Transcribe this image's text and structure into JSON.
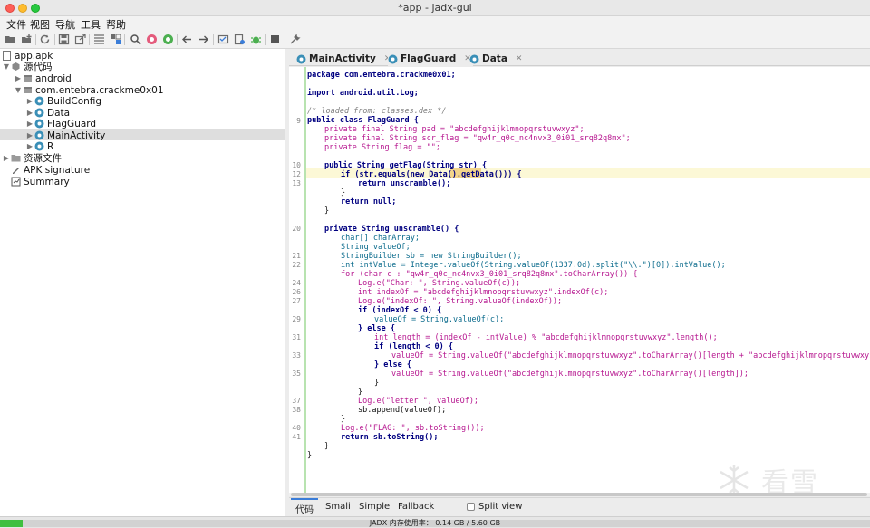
{
  "window": {
    "title": "*app - jadx-gui"
  },
  "menu": [
    "文件",
    "视图",
    "导航",
    "工具",
    "帮助"
  ],
  "toolbar_icons": [
    "open-icon",
    "add-files-icon",
    "reload-icon",
    "save-icon",
    "export-icon",
    "flatten-icon",
    "sync-icon",
    "search-icon",
    "find-class-icon",
    "find-usage-icon",
    "back-icon",
    "forward-icon",
    "quark-icon",
    "log-icon",
    "deobf-icon",
    "debug-icon",
    "stop-icon",
    "settings-icon"
  ],
  "tree": {
    "root": "app.apk",
    "source_code": "源代码",
    "android": "android",
    "package": "com.entebra.crackme0x01",
    "classes": [
      "BuildConfig",
      "Data",
      "FlagGuard",
      "MainActivity",
      "R"
    ],
    "resources": "资源文件",
    "apk_signature": "APK signature",
    "summary": "Summary"
  },
  "tabs": [
    "MainActivity",
    "FlagGuard",
    "Data"
  ],
  "code": {
    "line_numbers": [
      "9",
      "10",
      "12",
      "13",
      "20",
      "21",
      "22",
      "24",
      "26",
      "27",
      "29",
      "31",
      "33",
      "35",
      "37",
      "38",
      "40",
      "41"
    ],
    "lines": [
      "package com.entebra.crackme0x01;",
      "import android.util.Log;",
      "/* loaded from: classes.dex */",
      "public class FlagGuard {",
      "private final String pad = \"abcdefghijklmnopqrstuvwxyz\";",
      "private final String scr_flag = \"qw4r_q0c_nc4nvx3_0i01_srq82q8mx\";",
      "private String flag = \"\";",
      "public String getFlag(String str) {",
      "if (str.equals(new Data().getData())) {",
      "return unscramble();",
      "}",
      "return null;",
      "}",
      "private String unscramble() {",
      "char[] charArray;",
      "String valueOf;",
      "StringBuilder sb = new StringBuilder();",
      "int intValue = Integer.valueOf(String.valueOf(1337.0d).split(\"\\\\.\")[0]).intValue();",
      "for (char c : \"qw4r_q0c_nc4nvx3_0i01_srq82q8mx\".toCharArray()) {",
      "Log.e(\"Char: \", String.valueOf(c));",
      "int indexOf = \"abcdefghijklmnopqrstuvwxyz\".indexOf(c);",
      "Log.e(\"indexOf: \", String.valueOf(indexOf));",
      "if (indexOf < 0) {",
      "valueOf = String.valueOf(c);",
      "} else {",
      "int length = (indexOf - intValue) % \"abcdefghijklmnopqrstuvwxyz\".length();",
      "if (length < 0) {",
      "valueOf = String.valueOf(\"abcdefghijklmnopqrstuvwxyz\".toCharArray()[length + \"abcdefghijklmnopqrstuvwxyz\".length()",
      "} else {",
      "valueOf = String.valueOf(\"abcdefghijklmnopqrstuvwxyz\".toCharArray()[length]);",
      "}",
      "}",
      "Log.e(\"letter \", valueOf);",
      "sb.append(valueOf);",
      "}",
      "Log.e(\"FLAG: \", sb.toString());",
      "return sb.toString();",
      "}",
      "}"
    ]
  },
  "bottom_tabs": [
    "代码",
    "Smali",
    "Simple",
    "Fallback"
  ],
  "split_view": "Split view",
  "status": {
    "memory": "JADX 内存使用率： 0.14 GB / 5.60 GB",
    "usage_fraction": 0.025
  },
  "watermark": "看雪",
  "colors": {
    "accent": "#3b7dd8",
    "string": "#b6168f",
    "keyword": "#000080",
    "highlight": "#fcf8d6"
  }
}
